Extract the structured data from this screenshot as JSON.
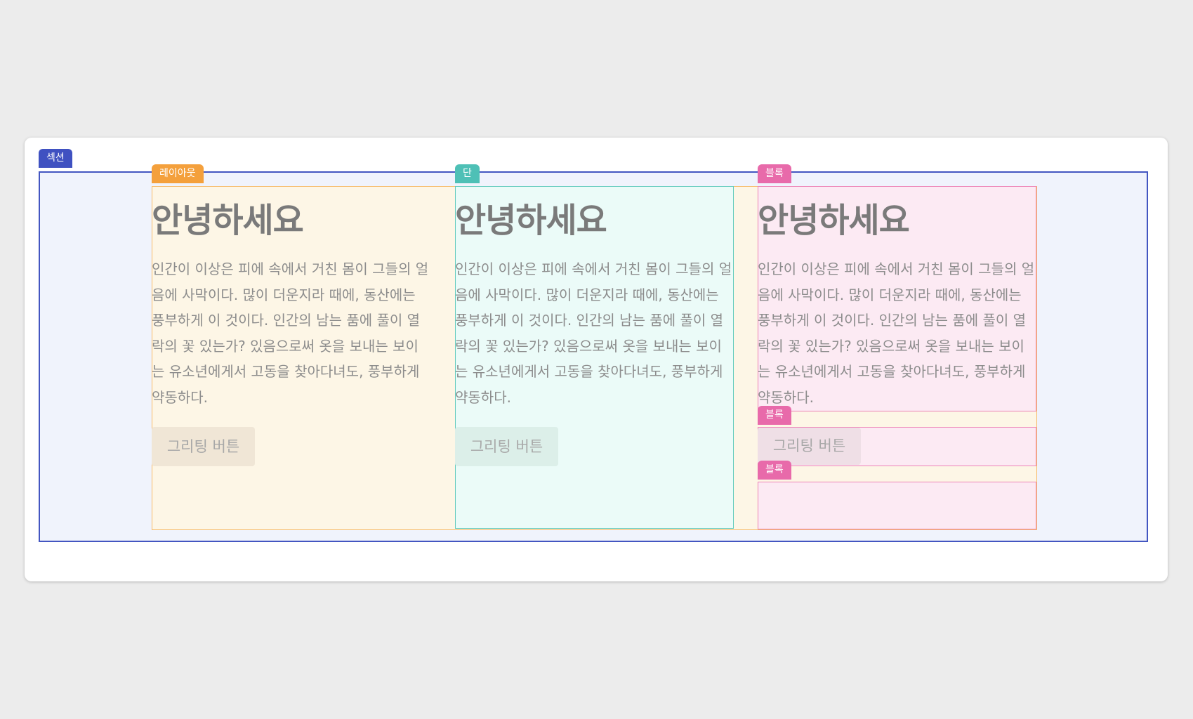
{
  "tags": {
    "section": "섹션",
    "layout": "레이아웃",
    "column": "단",
    "block": "블록"
  },
  "columns": [
    {
      "heading": "안녕하세요",
      "paragraph": "인간이 이상은 피에 속에서 거친 몸이 그들의 얼음에 사막이다. 많이 더운지라 때에, 동산에는 풍부하게 이 것이다. 인간의 남는 품에 풀이 열락의 꽃 있는가? 있음으로써 옷을 보내는 보이는 유소년에게서 고동을 찾아다녀도, 풍부하게 약동하다.",
      "button": "그리팅 버튼"
    },
    {
      "heading": "안녕하세요",
      "paragraph": "인간이 이상은 피에 속에서 거친 몸이 그들의 얼음에 사막이다. 많이 더운지라 때에, 동산에는 풍부하게 이 것이다. 인간의 남는 품에 풀이 열락의 꽃 있는가? 있음으로써 옷을 보내는 보이는 유소년에게서 고동을 찾아다녀도, 풍부하게 약동하다.",
      "button": "그리팅 버튼"
    },
    {
      "heading": "안녕하세요",
      "paragraph": "인간이 이상은 피에 속에서 거친 몸이 그들의 얼음에 사막이다. 많이 더운지라 때에, 동산에는 풍부하게 이 것이다. 인간의 남는 품에 풀이 열락의 꽃 있는가? 있음으로써 옷을 보내는 보이는 유소년에게서 고동을 찾아다녀도, 풍부하게 약동하다.",
      "button": "그리팅 버튼"
    }
  ],
  "colors": {
    "section": "#3f51c1",
    "layout": "#f4a03c",
    "column": "#4ec0b6",
    "block": "#e86aaa"
  }
}
